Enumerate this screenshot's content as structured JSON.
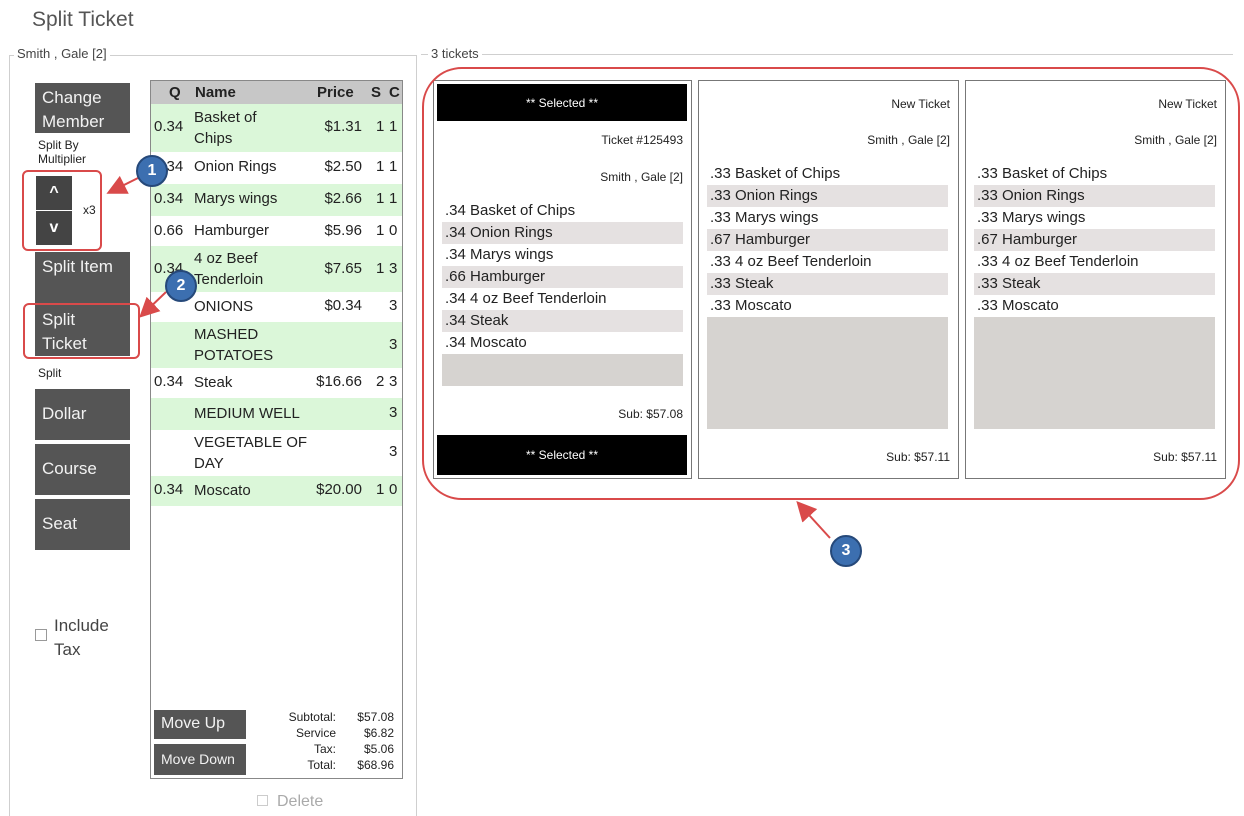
{
  "window": {
    "title": "Split Ticket"
  },
  "member_group": {
    "label": "Smith , Gale [2]"
  },
  "tickets_group": {
    "label": "3 tickets"
  },
  "left_buttons": {
    "change_member": "Change Member",
    "split_by_multiplier": "Split By Multiplier",
    "up_glyph": "^",
    "down_glyph": "v",
    "multiplier": "x3",
    "split_item": "Split Item",
    "split_ticket": "Split Ticket",
    "split_label": "Split",
    "dollar": "Dollar",
    "course": "Course",
    "seat": "Seat",
    "include_tax": "Include Tax"
  },
  "items": {
    "columns": {
      "q": "Q",
      "name": "Name",
      "price": "Price",
      "s": "S",
      "c": "C"
    },
    "rows": [
      {
        "q": "0.34",
        "name": "Basket of Chips",
        "price": "$1.31",
        "s": "1",
        "c": "1"
      },
      {
        "q": "0.34",
        "name": "Onion Rings",
        "price": "$2.50",
        "s": "1",
        "c": "1"
      },
      {
        "q": "0.34",
        "name": "Marys wings",
        "price": "$2.66",
        "s": "1",
        "c": "1"
      },
      {
        "q": "0.66",
        "name": "Hamburger",
        "price": "$5.96",
        "s": "1",
        "c": "0"
      },
      {
        "q": "0.34",
        "name": "4 oz Beef Tenderloin",
        "price": "$7.65",
        "s": "1",
        "c": "3"
      },
      {
        "q": "",
        "name": "ONIONS",
        "price": "$0.34",
        "s": "",
        "c": "3"
      },
      {
        "q": "",
        "name": "MASHED POTATOES",
        "price": "",
        "s": "",
        "c": "3"
      },
      {
        "q": "0.34",
        "name": "Steak",
        "price": "$16.66",
        "s": "2",
        "c": "3"
      },
      {
        "q": "",
        "name": "MEDIUM WELL",
        "price": "",
        "s": "",
        "c": "3"
      },
      {
        "q": "",
        "name": "VEGETABLE OF DAY",
        "price": "",
        "s": "",
        "c": "3"
      },
      {
        "q": "0.34",
        "name": "Moscato",
        "price": "$20.00",
        "s": "1",
        "c": "0"
      }
    ],
    "move_up": "Move Up",
    "move_down": "Move Down",
    "totals": {
      "subtotal_label": "Subtotal:",
      "subtotal": "$57.08",
      "service_label": "Service",
      "service": "$6.82",
      "tax_label": "Tax:",
      "tax": "$5.06",
      "total_label": "Total:",
      "total": "$68.96"
    },
    "delete_label": "Delete"
  },
  "tickets": [
    {
      "header": "** Selected **",
      "number": "Ticket #125493",
      "member": "Smith , Gale [2]",
      "lines": [
        ".34  Basket of Chips",
        ".34  Onion Rings",
        ".34  Marys wings",
        ".66  Hamburger",
        ".34  4 oz Beef Tenderloin",
        ".34  Steak",
        ".34  Moscato"
      ],
      "sub": "Sub: $57.08",
      "footer": "** Selected **"
    },
    {
      "header": "New Ticket",
      "member": "Smith , Gale [2]",
      "lines": [
        ".33  Basket of Chips",
        ".33  Onion Rings",
        ".33  Marys wings",
        ".67  Hamburger",
        ".33  4 oz Beef Tenderloin",
        ".33  Steak",
        ".33  Moscato"
      ],
      "sub": "Sub: $57.11"
    },
    {
      "header": "New Ticket",
      "member": "Smith , Gale [2]",
      "lines": [
        ".33  Basket of Chips",
        ".33  Onion Rings",
        ".33  Marys wings",
        ".67  Hamburger",
        ".33  4 oz Beef Tenderloin",
        ".33  Steak",
        ".33  Moscato"
      ],
      "sub": "Sub: $57.11"
    }
  ],
  "callouts": [
    "1",
    "2",
    "3"
  ],
  "colors": {
    "accent_red": "#d94a4a",
    "callout_blue": "#3c6fb0",
    "row_green": "#dbf7d9",
    "button_gray": "#555555"
  }
}
